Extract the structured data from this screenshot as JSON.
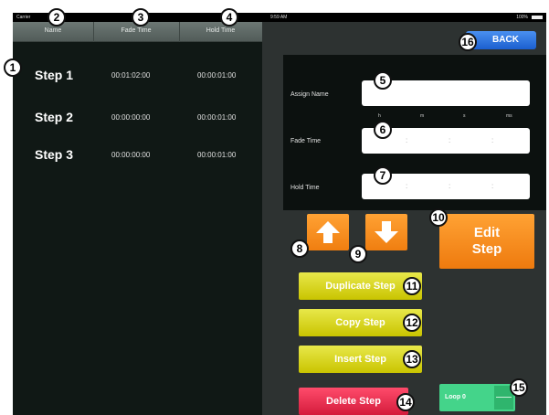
{
  "statusbar": {
    "carrier": "Carrier",
    "time": "9:59 AM",
    "battery": "100%"
  },
  "table": {
    "headers": {
      "name": "Name",
      "fade": "Fade Time",
      "hold": "Hold Time"
    },
    "rows": [
      {
        "name": "Step 1",
        "fade": "00:01:02:00",
        "hold": "00:00:01:00"
      },
      {
        "name": "Step 2",
        "fade": "00:00:00:00",
        "hold": "00:00:01:00"
      },
      {
        "name": "Step 3",
        "fade": "00:00:00:00",
        "hold": "00:00:01:00"
      }
    ]
  },
  "back_label": "BACK",
  "form": {
    "assign_name_label": "Assign Name",
    "assign_name_value": "",
    "units": {
      "h": "h",
      "m": "m",
      "s": "s",
      "ms": "ms"
    },
    "fade_time_label": "Fade Time",
    "hold_time_label": "Hold Time",
    "separator": ":"
  },
  "buttons": {
    "edit_line1": "Edit",
    "edit_line2": "Step",
    "duplicate": "Duplicate Step",
    "copy": "Copy Step",
    "insert": "Insert Step",
    "delete": "Delete Step"
  },
  "loop": {
    "label": "Loop 0"
  },
  "callouts": {
    "c1": "1",
    "c2": "2",
    "c3": "3",
    "c4": "4",
    "c5": "5",
    "c6": "6",
    "c7": "7",
    "c8": "8",
    "c9": "9",
    "c10": "10",
    "c11": "11",
    "c12": "12",
    "c13": "13",
    "c14": "14",
    "c15": "15",
    "c16": "16"
  },
  "colors": {
    "accent_orange": "#f07e10",
    "accent_yellow": "#c9c400",
    "accent_red": "#d41c3c",
    "accent_green": "#44d48a",
    "accent_blue": "#1b5fcf"
  }
}
